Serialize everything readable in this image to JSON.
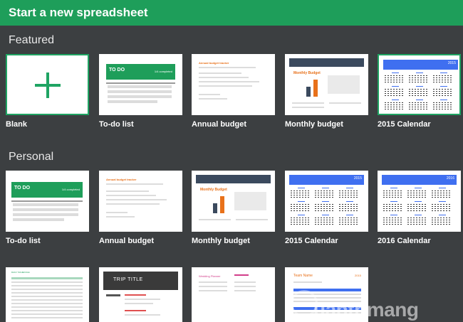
{
  "header": {
    "title": "Start a new spreadsheet"
  },
  "sections": {
    "featured": "Featured",
    "personal": "Personal"
  },
  "featured": [
    {
      "label": "Blank"
    },
    {
      "label": "To-do list"
    },
    {
      "label": "Annual budget"
    },
    {
      "label": "Monthly budget"
    },
    {
      "label": "2015 Calendar"
    }
  ],
  "personal": [
    {
      "label": "To-do list"
    },
    {
      "label": "Annual budget"
    },
    {
      "label": "Monthly budget"
    },
    {
      "label": "2015 Calendar"
    },
    {
      "label": "2016 Calendar"
    }
  ],
  "thumbs": {
    "todo_title": "TO DO",
    "todo_sub": "1/4 completed",
    "annual_title": "Annual budget tracker",
    "monthly_title": "Monthly Budget",
    "cal_2015": "2015",
    "cal_2016": "2016",
    "trip_title": "TRIP TITLE",
    "wedding_title": "Wedding Planner",
    "team_title": "Team Name",
    "team_year": "2015",
    "schedule_title": "DAILY SCHEDULE"
  },
  "watermark": "uantrimang",
  "colors": {
    "header": "#1e9e5a",
    "accent": "#1fa463",
    "background": "#3c3f41",
    "calendar_blue": "#3f6ff0"
  }
}
